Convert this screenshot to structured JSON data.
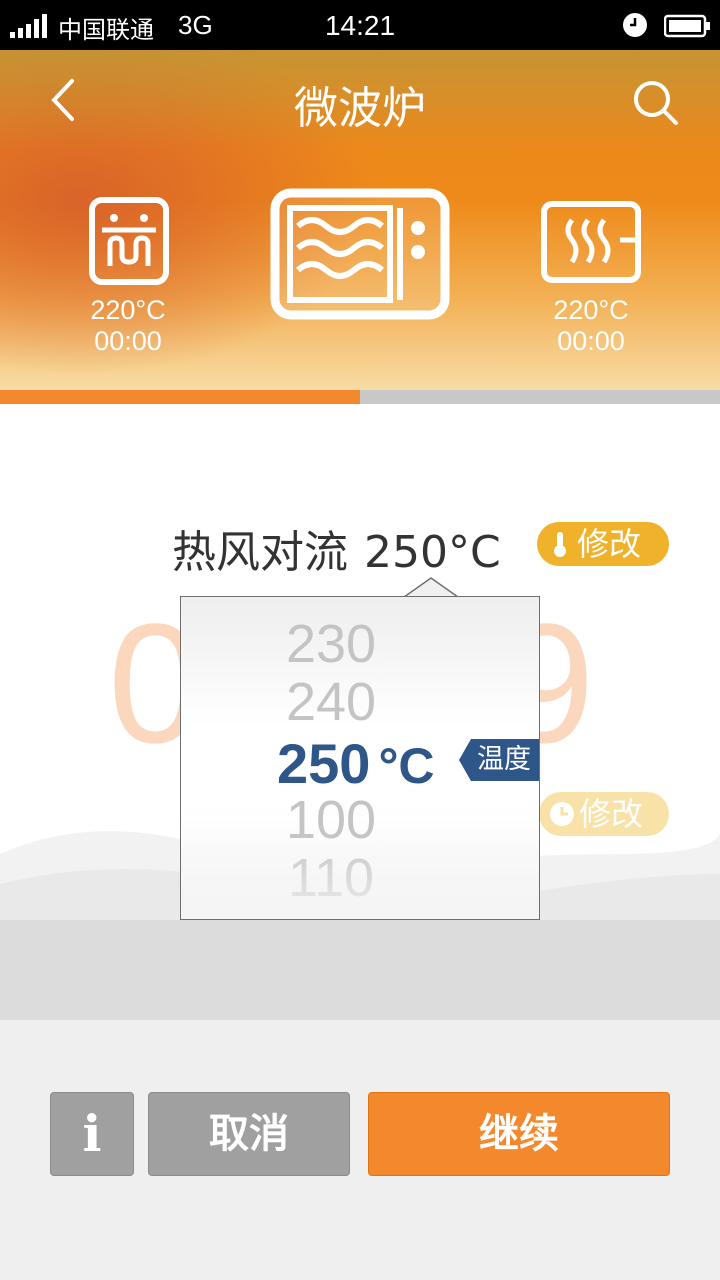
{
  "status_bar": {
    "carrier": "中国联通",
    "network": "3G",
    "time": "14:21"
  },
  "header": {
    "title": "微波炉"
  },
  "modes": {
    "left": {
      "temp": "220°C",
      "time": "00:00"
    },
    "right": {
      "temp": "220°C",
      "time": "00:00"
    }
  },
  "progress": {
    "fraction": 0.5
  },
  "settings": {
    "mode_name": "热风对流",
    "temperature": "250°C",
    "modify_temp_label": "修改",
    "modify_time_label": "修改",
    "timer_left_digit": "0",
    "timer_right_digit": "9"
  },
  "picker": {
    "options_above": [
      "230",
      "240"
    ],
    "selected_value": "250",
    "unit": "°C",
    "options_below": [
      "100",
      "110"
    ],
    "tag_label": "温度"
  },
  "buttons": {
    "info": "i",
    "cancel": "取消",
    "continue": "继续"
  },
  "colors": {
    "accent": "#f4882c",
    "picker_selected": "#2e5688",
    "pill_yellow": "#f0b22a"
  }
}
